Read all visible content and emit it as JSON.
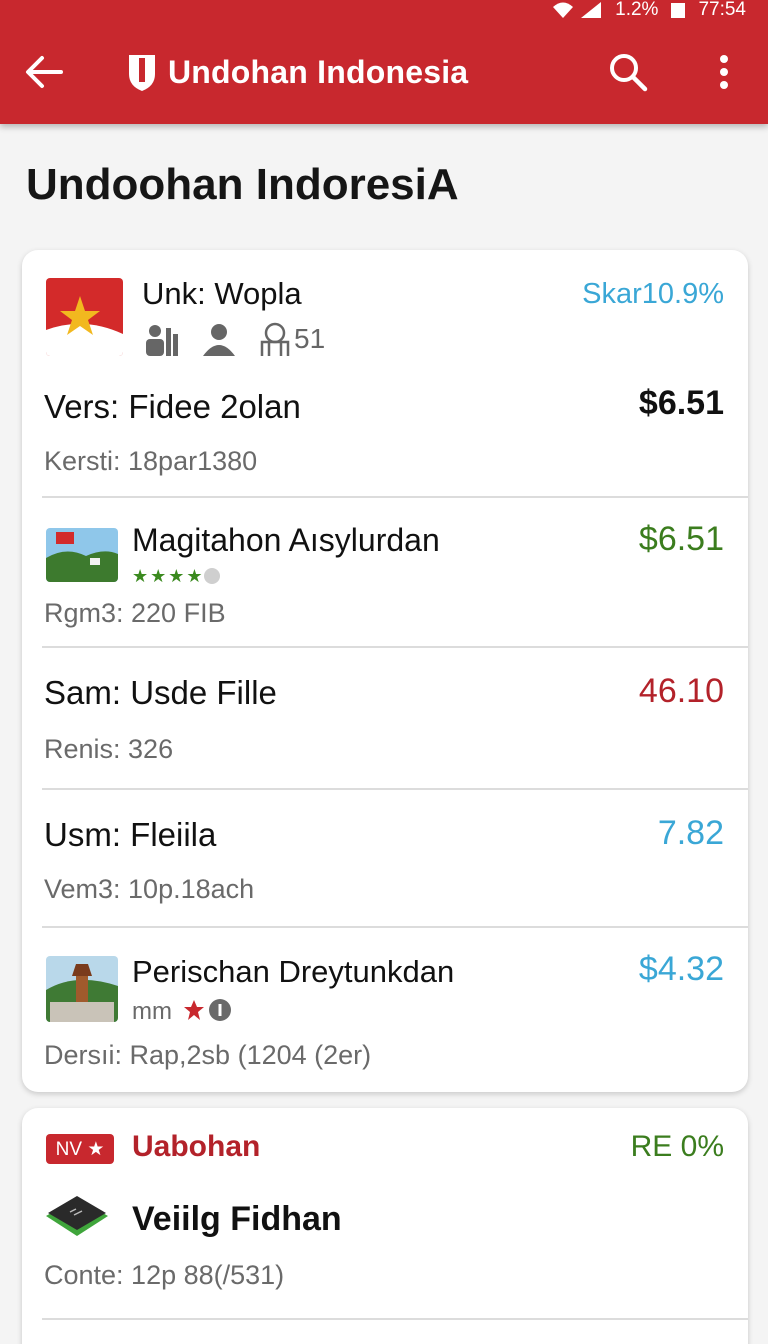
{
  "status_bar": {
    "battery": "1.2%",
    "time": "77:54"
  },
  "app_bar": {
    "title": "Undohan Indonesia",
    "back_icon": "arrow-left-icon",
    "search_icon": "search-icon",
    "more_icon": "more-vert-icon"
  },
  "page": {
    "title": "Undoohan IndoresiA"
  },
  "colors": {
    "brand_red": "#c8282e",
    "value_green": "#3b7d1e",
    "value_red": "#b3222a",
    "value_blue": "#3aa7d6"
  },
  "card1": {
    "header": {
      "name": "Unk: Wopla",
      "badge": "Skar10.9%",
      "stat_count": "51"
    },
    "items": [
      {
        "title": "Vers: Fidee 2olan",
        "subtitle": "Kersti: 18par1380",
        "value": "$6.51"
      },
      {
        "title": "Magitahon Aısylurdan",
        "rating": "★★★★",
        "subtitle": "Rgm3: 220 FIB",
        "value": "$6.51"
      },
      {
        "title": "Sam: Usde Fille",
        "subtitle": "Renis: 326",
        "value": "46.10"
      },
      {
        "title": "Usm: Fleiila",
        "subtitle": "Vem3: 10p.18ach",
        "value": "7.82"
      },
      {
        "title": "Perischan Dreytunkdan",
        "rating_text": "mm",
        "subtitle": "Dersıi: Rap,2sb (1204 (2er)",
        "value": "$4.32"
      }
    ]
  },
  "card2": {
    "tag": "NV ★",
    "name": "Uabohan",
    "badge": "RE 0%",
    "item": {
      "title": "Veiilg Fidhan",
      "subtitle": "Conte: 12p 88(/531)"
    }
  }
}
